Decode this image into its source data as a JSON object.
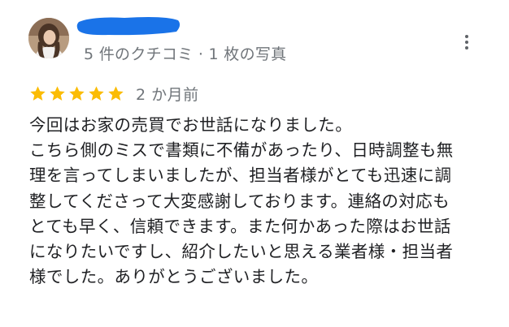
{
  "reviewer": {
    "meta": "5 件のクチコミ · 1 枚の写真"
  },
  "review": {
    "rating": 5,
    "rating_max": 5,
    "date": "2 か月前",
    "lines": [
      "今回はお家の売買でお世話になりました。",
      "こちら側のミスで書類に不備があったり、日時調整も無",
      "理を言ってしまいましたが、担当者様がとても迅速に調",
      "整してくださって大変感謝しております。連絡の対応も",
      "とても早く、信頼できます。また何かあった際はお世話",
      "になりたいですし、紹介したいと思える業者様・担当者",
      "様でした。ありがとうございました。"
    ]
  },
  "colors": {
    "star": "#fbbc04",
    "redaction": "#1a73e8",
    "secondary_text": "#70757a",
    "primary_text": "#202124"
  },
  "icons": {
    "more": "more-vert-icon",
    "star": "star-icon"
  }
}
